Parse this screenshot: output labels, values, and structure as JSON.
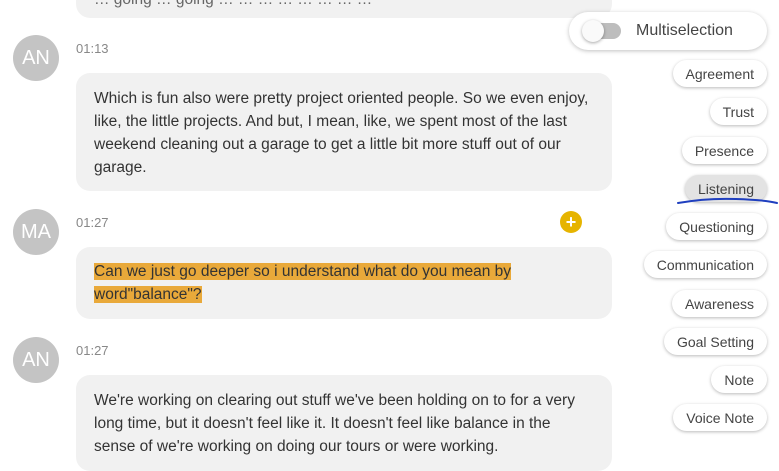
{
  "messages": [
    {
      "initials": "",
      "time": "",
      "text": "… going … going … … … … … … … …"
    },
    {
      "initials": "AN",
      "time": "01:13",
      "text": "Which is fun also were pretty project oriented people. So we even enjoy, like, the little projects. And but, I mean, like, we spent most of the last weekend cleaning out a garage to get a little bit more stuff out of our garage."
    },
    {
      "initials": "MA",
      "time": "01:27",
      "text": "Can we just go deeper so i understand what do you mean by word\"balance\"?"
    },
    {
      "initials": "AN",
      "time": "01:27",
      "text": "We're working on clearing out stuff we've been holding on to for a very long time, but it doesn't feel like it. It doesn't feel like balance in the sense of we're working on doing our tours or were working."
    }
  ],
  "add_button": "+",
  "multiselection": {
    "label": "Multiselection",
    "enabled": false
  },
  "tags": [
    "Agreement",
    "Trust",
    "Presence",
    "Listening",
    "Questioning",
    "Communication",
    "Awareness",
    "Goal Setting",
    "Note",
    "Voice Note"
  ],
  "selected_tag": "Listening",
  "colors": {
    "highlight": "#e9a93a",
    "add_button": "#e6b400",
    "annotation_stroke": "#1f3fbf"
  }
}
